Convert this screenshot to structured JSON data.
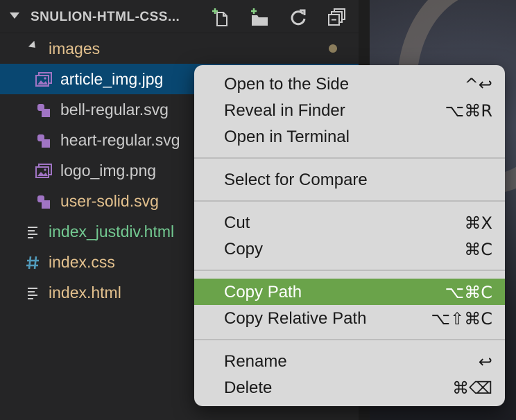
{
  "explorer": {
    "title": "SNULION-HTML-CSS...",
    "actions": [
      {
        "name": "new-file",
        "icon": "new-file-icon"
      },
      {
        "name": "new-folder",
        "icon": "new-folder-icon"
      },
      {
        "name": "refresh",
        "icon": "refresh-icon"
      },
      {
        "name": "collapse-all",
        "icon": "collapse-all-icon"
      }
    ],
    "items": [
      {
        "label": "images",
        "type": "folder",
        "expanded": true,
        "badge": "dot"
      },
      {
        "label": "article_img.jpg",
        "type": "image",
        "selected": true
      },
      {
        "label": "bell-regular.svg",
        "type": "svg"
      },
      {
        "label": "heart-regular.svg",
        "type": "svg"
      },
      {
        "label": "logo_img.png",
        "type": "image"
      },
      {
        "label": "user-solid.svg",
        "type": "svg",
        "status": "modified"
      },
      {
        "label": "index_justdiv.html",
        "type": "html",
        "status": "untracked"
      },
      {
        "label": "index.css",
        "type": "css",
        "status": "modified"
      },
      {
        "label": "index.html",
        "type": "html",
        "status": "modified"
      }
    ]
  },
  "context_menu": {
    "groups": [
      [
        {
          "label": "Open to the Side",
          "shortcut": "^↩"
        },
        {
          "label": "Reveal in Finder",
          "shortcut": "⌥⌘R"
        },
        {
          "label": "Open in Terminal",
          "shortcut": ""
        }
      ],
      [
        {
          "label": "Select for Compare",
          "shortcut": ""
        }
      ],
      [
        {
          "label": "Cut",
          "shortcut": "⌘X"
        },
        {
          "label": "Copy",
          "shortcut": "⌘C"
        }
      ],
      [
        {
          "label": "Copy Path",
          "shortcut": "⌥⌘C",
          "highlighted": true
        },
        {
          "label": "Copy Relative Path",
          "shortcut": "⌥⇧⌘C"
        }
      ],
      [
        {
          "label": "Rename",
          "shortcut": "↩"
        },
        {
          "label": "Delete",
          "shortcut": "⌘⌫"
        }
      ]
    ]
  },
  "colors": {
    "sidebar_bg": "#252526",
    "selection_bg": "#094771",
    "menu_bg": "#d9d9d9",
    "menu_highlight": "#6aa34a",
    "folder_text": "#e2c08d",
    "untracked_text": "#73c991",
    "svg_icon": "#a074c4",
    "css_icon": "#519aba"
  }
}
